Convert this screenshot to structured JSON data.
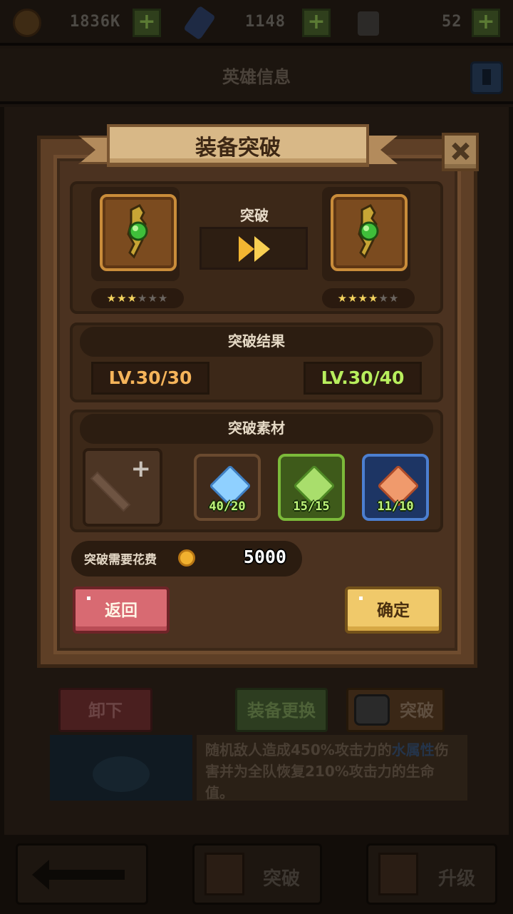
{
  "topbar": {
    "gold": {
      "value": "1836K",
      "icon": "coin-icon"
    },
    "gems": {
      "value": "1148",
      "icon": "gem-icon"
    },
    "keys": {
      "value": "52",
      "icon": "lock-icon"
    },
    "plus": "+"
  },
  "header": {
    "title": "英雄信息"
  },
  "background": {
    "unequip_label": "卸下",
    "swap_label": "装备更换",
    "break_label": "突破",
    "desc_pre": "随机敌人造成450%攻击力的",
    "desc_elem": "水属性",
    "desc_post": "伤害并为全队恢复210%攻击力的生命值。"
  },
  "bottom_nav": {
    "break_label": "突破",
    "upgrade_label": "升级"
  },
  "dialog": {
    "title": "装备突破",
    "break_label": "突破",
    "before": {
      "stars_filled": 3,
      "stars_total": 6,
      "stars_text": [
        "★",
        "★",
        "★",
        "★",
        "★",
        "★"
      ]
    },
    "after": {
      "stars_filled": 4,
      "stars_total": 6,
      "stars_text": [
        "★",
        "★",
        "★",
        "★",
        "★",
        "★"
      ]
    },
    "result_title": "突破结果",
    "level_before": "LV.30/30",
    "level_after": "LV.30/40",
    "materials_title": "突破素材",
    "empty_plus": "+",
    "materials": [
      {
        "name": "ice-crystal",
        "count": "40/20",
        "color": "#8fd0ff"
      },
      {
        "name": "nature-crystal",
        "count": "15/15",
        "color": "#a9de6c"
      },
      {
        "name": "fire-crystal",
        "count": "11/10",
        "color": "#f09a6c"
      }
    ],
    "cost_label": "突破需要花费",
    "cost_value": "5000",
    "back_label": "返回",
    "confirm_label": "确定"
  }
}
